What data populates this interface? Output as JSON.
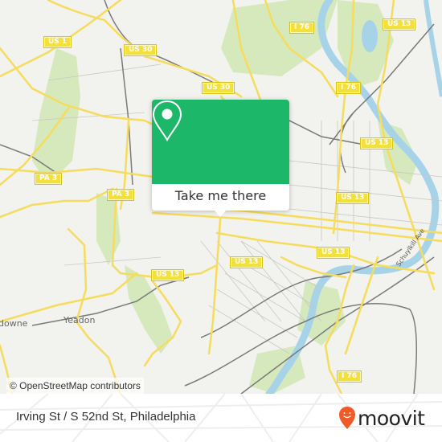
{
  "map": {
    "background_color": "#f2f2ee",
    "road_color": "#f6dc5c",
    "park_color": "#d6e9bd",
    "water_color": "#a7d3e8",
    "rail_color": "#7a7a7a",
    "route_shields": [
      {
        "label": "US 1"
      },
      {
        "label": "US 30"
      },
      {
        "label": "US 30"
      },
      {
        "label": "I 76"
      },
      {
        "label": "I 76"
      },
      {
        "label": "US 13"
      },
      {
        "label": "US 13"
      },
      {
        "label": "US 13"
      },
      {
        "label": "US 13"
      },
      {
        "label": "US 13"
      },
      {
        "label": "US 13"
      },
      {
        "label": "PA 3"
      },
      {
        "label": "PA 3"
      },
      {
        "label": "I 76"
      }
    ],
    "place_labels": [
      {
        "label": "Yeadon"
      },
      {
        "label": "downe"
      }
    ],
    "street_label": "Schuylkill Ave",
    "attribution": "© OpenStreetMap contributors"
  },
  "popup": {
    "icon": "location-pin-icon",
    "accent_color": "#1db76a",
    "button_label": "Take me there"
  },
  "footer": {
    "address": "Irving St / S 52nd St, Philadelphia",
    "brand": "moovit",
    "brand_color": "#f05a28"
  }
}
